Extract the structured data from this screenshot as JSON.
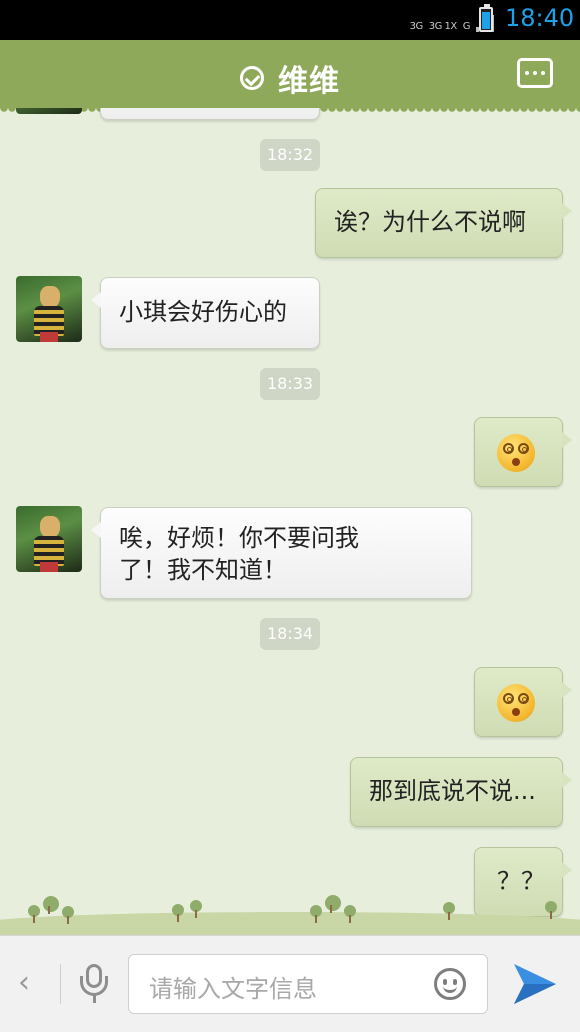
{
  "status_bar": {
    "network_labels": [
      "3G",
      "3G 1X",
      "G"
    ],
    "time": "18:40"
  },
  "header": {
    "title": "维维",
    "status_icon": "check-circle-icon",
    "menu_icon": "more-dots-icon"
  },
  "messages": [
    {
      "kind": "time",
      "text": "18:32"
    },
    {
      "kind": "msg",
      "side": "right",
      "text": "诶？为什么不说啊"
    },
    {
      "kind": "msg",
      "side": "left",
      "text": "小琪会好伤心的"
    },
    {
      "kind": "time",
      "text": "18:33"
    },
    {
      "kind": "msg",
      "side": "right",
      "emoji": "dizzy-face-icon"
    },
    {
      "kind": "msg",
      "side": "left",
      "lines": [
        "唉，好烦！你不要问我",
        "了！我不知道！"
      ]
    },
    {
      "kind": "time",
      "text": "18:34"
    },
    {
      "kind": "msg",
      "side": "right",
      "emoji": "dizzy-face-icon"
    },
    {
      "kind": "msg",
      "side": "right",
      "text": "那到底说不说..."
    },
    {
      "kind": "msg",
      "side": "right",
      "text": "？？"
    }
  ],
  "input_bar": {
    "placeholder": "请输入文字信息",
    "icons": [
      "back-chevron-icon",
      "microphone-icon",
      "smiley-icon",
      "send-icon"
    ]
  }
}
